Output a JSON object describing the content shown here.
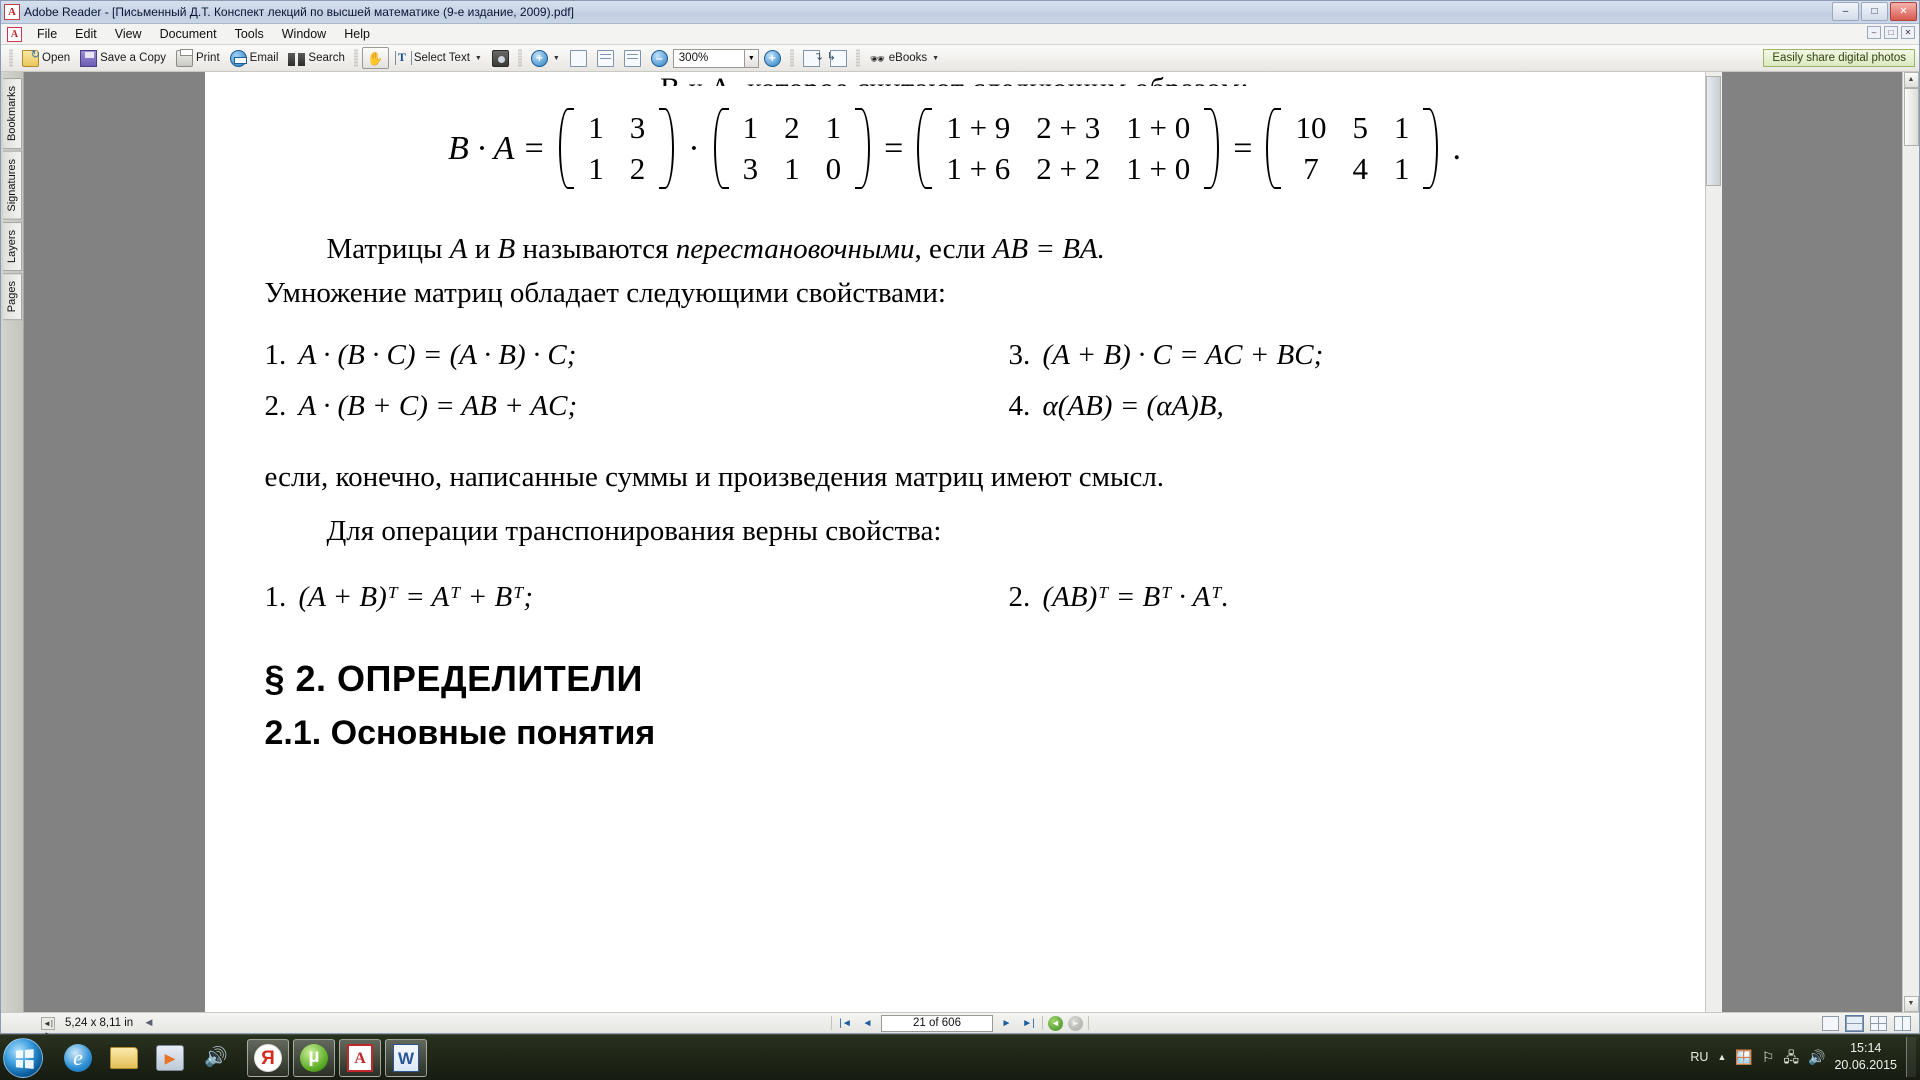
{
  "window": {
    "title": "Adobe Reader - [Письменный Д.Т. Конспект лекций по высшей математике (9-е издание, 2009).pdf]",
    "app_icon": "adobe-reader-icon",
    "buttons": {
      "minimize": "–",
      "maximize": "□",
      "close": "✕"
    }
  },
  "menubar": {
    "items": [
      "File",
      "Edit",
      "View",
      "Document",
      "Tools",
      "Window",
      "Help"
    ],
    "mini_window_buttons": [
      "–",
      "□",
      "✕"
    ]
  },
  "toolbar": {
    "open_label": "Open",
    "save_label": "Save a Copy",
    "print_label": "Print",
    "email_label": "Email",
    "search_label": "Search",
    "hand_tool": "hand-tool-icon",
    "select_text_label": "Select Text",
    "snapshot_tool": "snapshot-tool-icon",
    "zoom_in_tool": "zoom-in-icon",
    "actual_size": "actual-size-icon",
    "fit_page": "fit-page-icon",
    "fit_width": "fit-width-icon",
    "zoom_out_label": "zoom-out-icon",
    "zoom_value": "300%",
    "zoom_in_label": "zoom-in-icon",
    "previous_view": "previous-view-icon",
    "next_view": "next-view-icon",
    "ebooks_label": "eBooks",
    "share_banner": "Easily share digital photos",
    "share_banner_color": "#dce9c0"
  },
  "sidebar": {
    "tabs": [
      {
        "label": "Bookmarks"
      },
      {
        "label": "Signatures"
      },
      {
        "label": "Layers"
      },
      {
        "label": "Pages"
      }
    ]
  },
  "document": {
    "cut_top_line": "В x A, которое считают следующим образом:",
    "equation": {
      "lead": "B · A =",
      "m1": [
        [
          "1",
          "3"
        ],
        [
          "1",
          "2"
        ]
      ],
      "op1": "·",
      "m2": [
        [
          "1",
          "2",
          "1"
        ],
        [
          "3",
          "1",
          "0"
        ]
      ],
      "eq1": "=",
      "m3": [
        [
          "1 + 9",
          "2 + 3",
          "1 + 0"
        ],
        [
          "1 + 6",
          "2 + 2",
          "1 + 0"
        ]
      ],
      "eq2": "=",
      "m4": [
        [
          "10",
          "5",
          "1"
        ],
        [
          "7",
          "4",
          "1"
        ]
      ],
      "tail": "."
    },
    "para1_a": "Матрицы ",
    "para1_b": "A",
    "para1_c": " и ",
    "para1_d": "B",
    "para1_e": " называются ",
    "para1_f": "перестановочными",
    "para1_g": ", если ",
    "para1_h": "AB = BA.",
    "para2": "Умножение матриц обладает следующими свойствами:",
    "properties": [
      {
        "num": "1.",
        "text": "A · (B · C) = (A · B) · C;"
      },
      {
        "num": "3.",
        "text": "(A + B) · C = AC + BC;"
      },
      {
        "num": "2.",
        "text": "A · (B + C) = AB + AC;"
      },
      {
        "num": "4.",
        "text": "α(AB) = (αA)B,"
      }
    ],
    "para3": "если, конечно, написанные суммы и произведения матриц имеют смысл.",
    "para4": "Для операции транспонирования верны свойства:",
    "transpose": [
      {
        "num": "1.",
        "text": "(A + B)ᵀ = Aᵀ + Bᵀ;"
      },
      {
        "num": "2.",
        "text": "(AB)ᵀ = Bᵀ · Aᵀ."
      }
    ],
    "section_heading": "§ 2.  ОПРЕДЕЛИТЕЛИ",
    "sub_heading": "2.1.  Основные понятия"
  },
  "statusbar": {
    "page_size": "5,24 x 8,11 in",
    "collapse_arrow": "◄",
    "nav": {
      "first": "|◄",
      "prev": "◄",
      "page_indicator": "21 of 606",
      "next": "►",
      "last": "►|",
      "previous_view": "◄",
      "next_view": "►"
    },
    "layout_buttons": [
      "single-page-icon",
      "continuous-icon",
      "facing-grid-icon",
      "continuous-facing-icon"
    ]
  },
  "taskbar": {
    "start": "start-orb-icon",
    "quick_launch": [
      {
        "name": "internet-explorer-icon"
      },
      {
        "name": "windows-explorer-icon"
      },
      {
        "name": "windows-media-player-icon"
      },
      {
        "name": "volume-icon"
      }
    ],
    "running": [
      {
        "name": "yandex-browser-icon"
      },
      {
        "name": "utorrent-icon"
      },
      {
        "name": "adobe-reader-icon"
      },
      {
        "name": "microsoft-word-icon"
      }
    ],
    "tray": {
      "language": "RU",
      "show_hidden": "▲",
      "icons": [
        "windows-flag-icon",
        "flag-icon",
        "network-icon",
        "volume-icon"
      ],
      "time": "15:14",
      "date": "20.06.2015"
    }
  }
}
